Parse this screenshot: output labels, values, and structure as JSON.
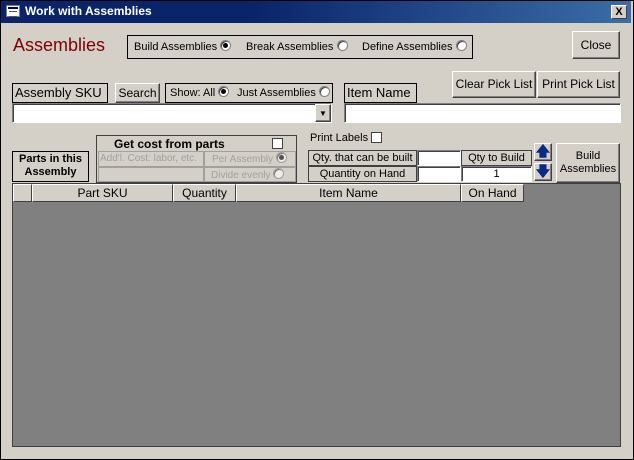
{
  "window": {
    "title": "Work with Assemblies",
    "close_glyph": "X"
  },
  "header": {
    "heading": "Assemblies"
  },
  "mode": {
    "options": [
      {
        "label": "Build Assemblies",
        "selected": true
      },
      {
        "label": "Break Assemblies",
        "selected": false
      },
      {
        "label": "Define Assemblies",
        "selected": false
      }
    ]
  },
  "buttons": {
    "close": "Close",
    "search": "Search",
    "clear_pick_list": "Clear Pick List",
    "print_pick_list": "Print Pick List",
    "build_assemblies_line1": "Build",
    "build_assemblies_line2": "Assemblies"
  },
  "assembly_sku": {
    "label": "Assembly SKU",
    "value": ""
  },
  "show_filter": {
    "prefix": "Show:",
    "options": [
      {
        "label": "All",
        "selected": true
      },
      {
        "label": "Just Assemblies",
        "selected": false
      }
    ]
  },
  "item_name": {
    "label": "Item Name",
    "value": ""
  },
  "cost": {
    "title": "Get cost from parts",
    "checked": false,
    "addl_cost_placeholder": "Add'l. Cost: labor, etc.",
    "per_assembly": "Per Assembly",
    "divide_evenly": "Divide evenly"
  },
  "parts_label_line1": "Parts in this",
  "parts_label_line2": "Assembly",
  "print_labels": {
    "label": "Print Labels",
    "checked": false
  },
  "quantities": {
    "can_be_built_label": "Qty. that can be built",
    "can_be_built_value": "",
    "on_hand_label": "Quantity on Hand",
    "on_hand_value": "",
    "qty_to_build_label": "Qty to Build",
    "qty_to_build_value": "1"
  },
  "arrows": {
    "up": "🡅",
    "down": "🡇"
  },
  "table": {
    "columns": [
      "Part SKU",
      "Quantity",
      "Item Name",
      "On Hand"
    ],
    "rows": []
  }
}
